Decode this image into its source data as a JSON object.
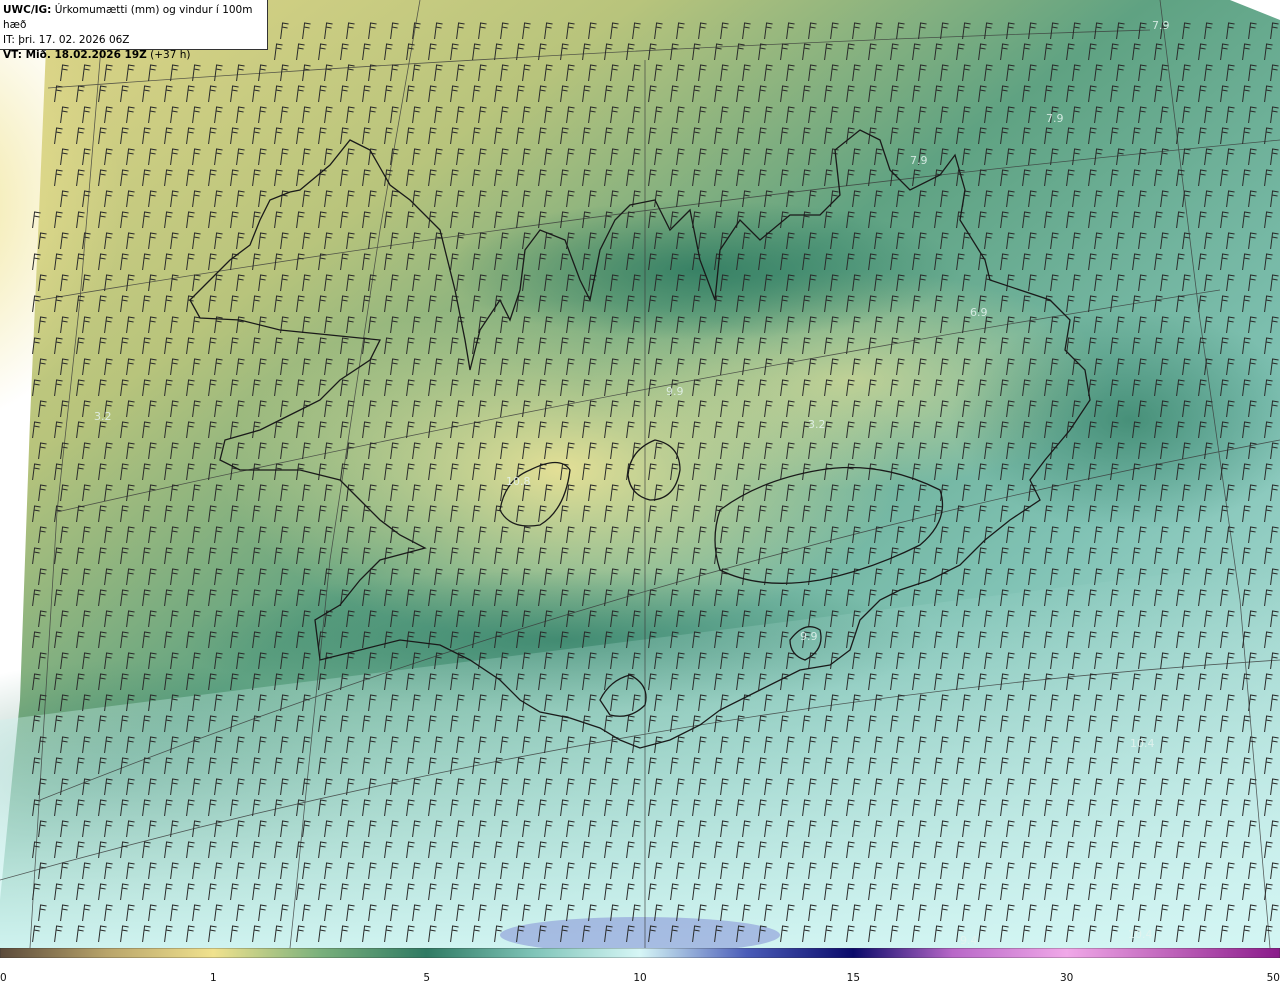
{
  "header": {
    "model_code": "UWC/IG:",
    "product": "Úrkomumætti (mm) og vindur í 100m hæð",
    "it_line": "IT: þri. 17. 02. 2026 06Z",
    "vt_bold": "VT: Mið. 18.02.2026 19Z",
    "vt_offset": "(+37 h)"
  },
  "map_labels": [
    "7.9",
    "7.9",
    "7.9",
    "3.2",
    "9.9",
    "3.2",
    "6.9",
    "9.9",
    "10.4",
    "9.4",
    "10.4",
    "10.8"
  ],
  "colorbar": {
    "unit": "mm",
    "ticks": [
      {
        "label": "0",
        "value": 0
      },
      {
        "label": "1",
        "value": 1
      },
      {
        "label": "5",
        "value": 5
      },
      {
        "label": "10",
        "value": 10
      },
      {
        "label": "15",
        "value": 15
      },
      {
        "label": "30",
        "value": 30
      },
      {
        "label": "50",
        "value": 50
      }
    ],
    "stops": [
      {
        "value": 0,
        "color": "#5b4a3a"
      },
      {
        "value": 0.5,
        "color": "#b8a46a"
      },
      {
        "value": 1,
        "color": "#f0e28e"
      },
      {
        "value": 3,
        "color": "#7ab07c"
      },
      {
        "value": 5,
        "color": "#2f7a63"
      },
      {
        "value": 7.5,
        "color": "#7fc4b8"
      },
      {
        "value": 10,
        "color": "#d6f6f6"
      },
      {
        "value": 12.5,
        "color": "#4a5cb8"
      },
      {
        "value": 15,
        "color": "#0a0a6a"
      },
      {
        "value": 22,
        "color": "#b868c8"
      },
      {
        "value": 30,
        "color": "#f0a8e8"
      },
      {
        "value": 50,
        "color": "#8a1a8a"
      }
    ]
  },
  "colors": {
    "field_west": "#e8dc8c",
    "field_mid": "#4f9a78",
    "field_east": "#8cc8bc",
    "field_south": "#c8eeea",
    "coast": "#1a1a1a",
    "barb": "#2a2a2a"
  }
}
